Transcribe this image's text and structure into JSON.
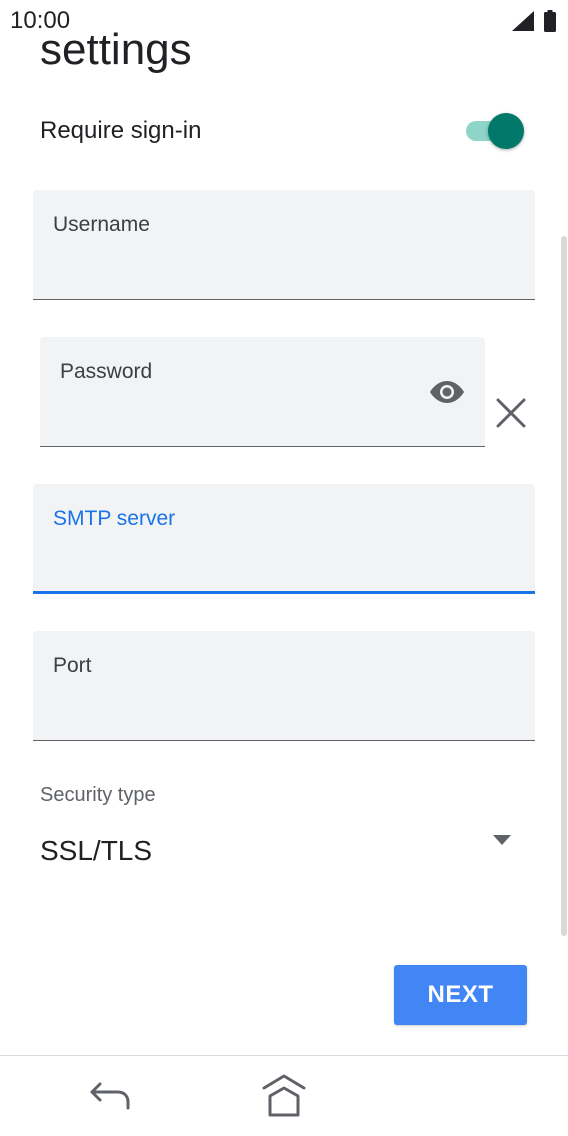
{
  "status_bar": {
    "time": "10:00",
    "icons": [
      "signal-icon",
      "battery-icon"
    ]
  },
  "page": {
    "title": "settings"
  },
  "require_signin": {
    "label": "Require sign-in",
    "enabled": true,
    "accent_color": "#00796b"
  },
  "fields": {
    "username": {
      "label": "Username",
      "value": ""
    },
    "password": {
      "label": "Password",
      "value": ""
    },
    "smtp_server": {
      "label": "SMTP server",
      "value": "",
      "focused": true
    },
    "port": {
      "label": "Port",
      "value": ""
    }
  },
  "security": {
    "label": "Security type",
    "value": "SSL/TLS"
  },
  "actions": {
    "next_label": "NEXT",
    "next_color": "#4285f4"
  },
  "nav": {
    "icons": [
      "back-icon",
      "home-icon"
    ]
  }
}
